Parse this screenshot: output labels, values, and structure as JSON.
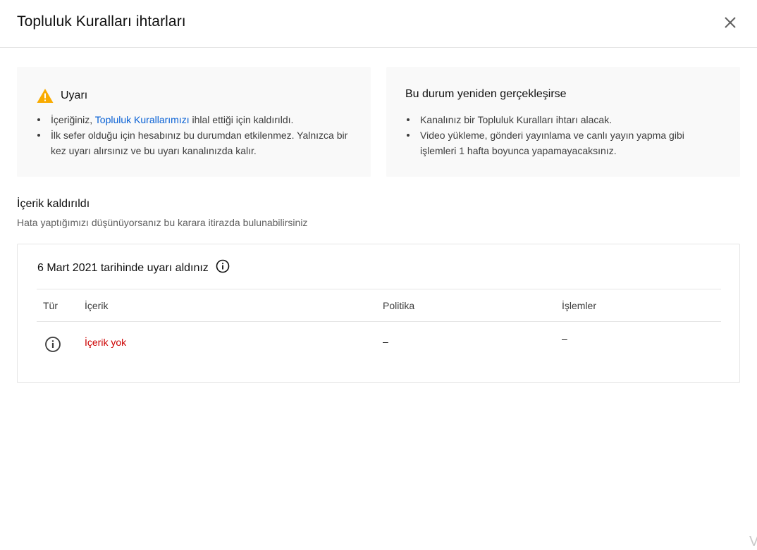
{
  "dialog": {
    "title": "Topluluk Kuralları ihtarları",
    "close_icon": "close-icon"
  },
  "warning_card": {
    "icon": "warning-icon",
    "icon_color": "#f9ab00",
    "heading": "Uyarı",
    "item1_prefix": "İçeriğiniz, ",
    "item1_link": "Topluluk Kurallarımızı",
    "item1_suffix": " ihlal ettiği için kaldırıldı.",
    "item2": "İlk sefer olduğu için hesabınız bu durumdan etkilenmez. Yalnızca bir kez uyarı alırsınız ve bu uyarı kanalınızda kalır."
  },
  "repeat_card": {
    "heading": "Bu durum yeniden gerçekleşirse",
    "items": [
      "Kanalınız bir Topluluk Kuralları ihtarı alacak.",
      "Video yükleme, gönderi yayınlama ve canlı yayın yapma gibi işlemleri 1 hafta boyunca yapamayacaksınız."
    ]
  },
  "section": {
    "title": "İçerik kaldırıldı",
    "subtitle": "Hata yaptığımızı düşünüyorsanız bu karara itirazda bulunabilirsiniz"
  },
  "strike_table": {
    "title": "6 Mart 2021 tarihinde uyarı aldınız",
    "title_icon": "info-icon",
    "columns": [
      "Tür",
      "İçerik",
      "Politika",
      "İşlemler"
    ],
    "rows": [
      {
        "type_icon": "info-icon",
        "content": "İçerik yok",
        "policy": "–",
        "actions": "–"
      }
    ]
  },
  "colors": {
    "link": "#065fd4",
    "error": "#cc0000",
    "card_bg": "#f9f9f9",
    "border": "#e5e5e5"
  },
  "watermark": "V"
}
